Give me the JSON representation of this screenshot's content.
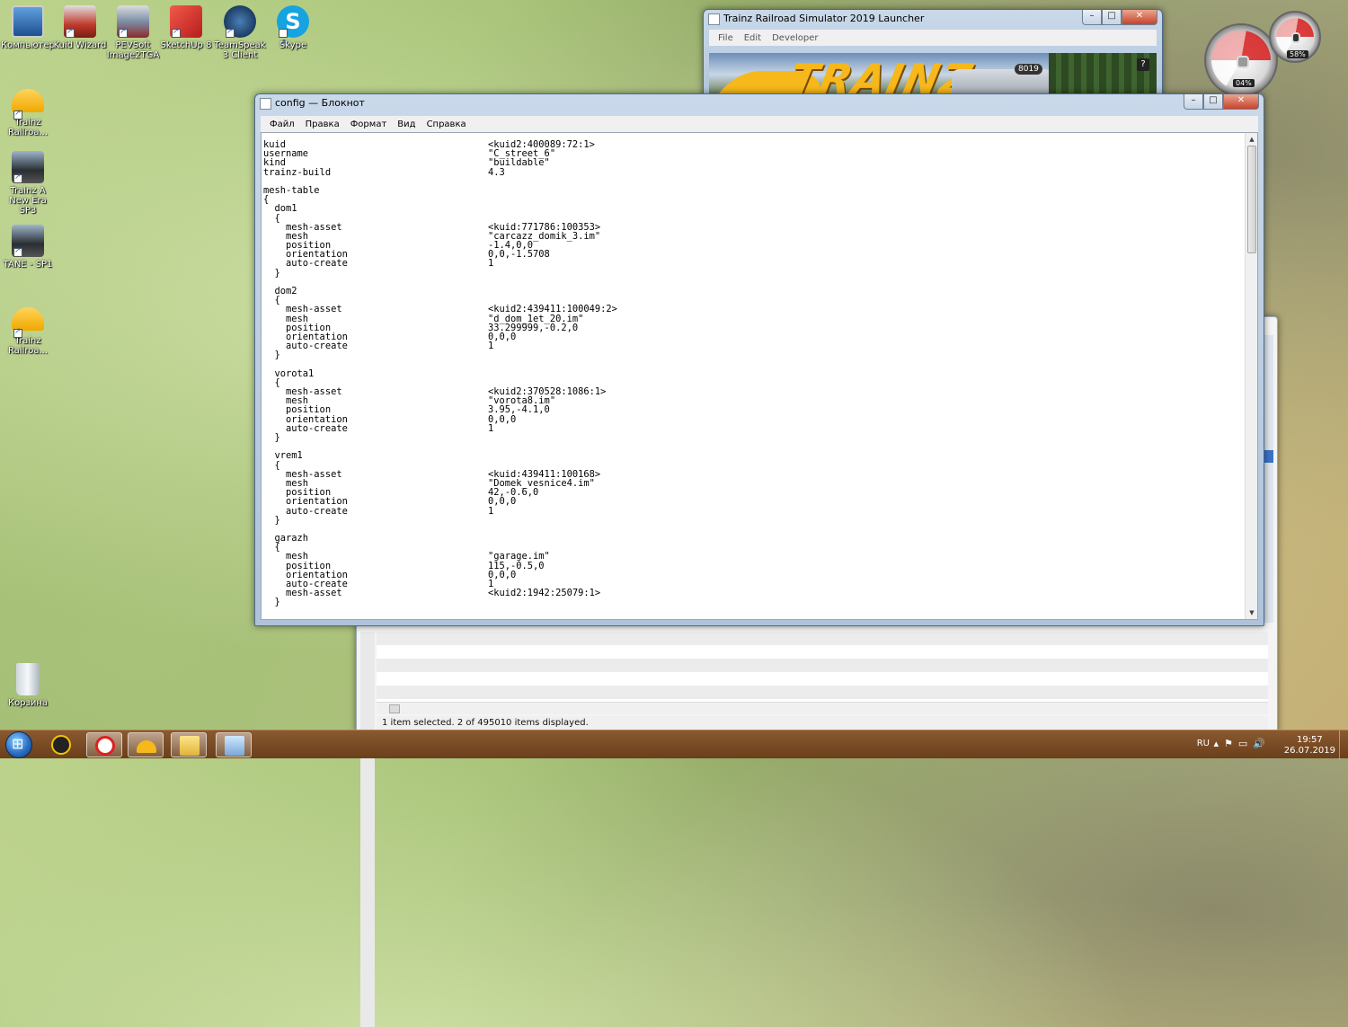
{
  "desktop": {
    "icons": [
      {
        "label": "Компьютер"
      },
      {
        "label": "Kuid Wizard"
      },
      {
        "label": "PEVSoft Image2TGA"
      },
      {
        "label": "SketchUp 8"
      },
      {
        "label": "TeamSpeak 3 Client"
      },
      {
        "label": "Skype"
      },
      {
        "label": "Trainz Railroa..."
      },
      {
        "label": "Trainz A New Era SP3"
      },
      {
        "label": "TANE - SP1"
      },
      {
        "label": "Trainz Railroa..."
      },
      {
        "label": "Корзина"
      }
    ]
  },
  "launcher": {
    "title": "Trainz Railroad Simulator 2019 Launcher",
    "menu": [
      "File",
      "Edit",
      "Developer"
    ],
    "logo_text": "TRAINZ",
    "loco_number": "8019",
    "help_label": "?"
  },
  "gadget": {
    "cpu_percent": "04%",
    "mem_percent": "58%"
  },
  "explorer": {
    "status_text": "1 item selected. 2 of 495010 items displayed."
  },
  "notepad": {
    "title": "config — Блокнот",
    "menu": [
      "Файл",
      "Правка",
      "Формат",
      "Вид",
      "Справка"
    ],
    "lines": [
      {
        "key": "kuid",
        "value": "<kuid2:400089:72:1>"
      },
      {
        "key": "username",
        "value": "\"C_street_6\""
      },
      {
        "key": "kind",
        "value": "\"buildable\""
      },
      {
        "key": "trainz-build",
        "value": "4.3"
      },
      {
        "key": "",
        "value": ""
      },
      {
        "key": "mesh-table",
        "value": ""
      },
      {
        "key": "{",
        "value": ""
      },
      {
        "key": "  dom1",
        "value": ""
      },
      {
        "key": "  {",
        "value": ""
      },
      {
        "key": "    mesh-asset",
        "value": "<kuid:771786:100353>"
      },
      {
        "key": "    mesh",
        "value": "\"carcazz_domik_3.im\""
      },
      {
        "key": "    position",
        "value": "-1.4,0,0"
      },
      {
        "key": "    orientation",
        "value": "0,0,-1.5708"
      },
      {
        "key": "    auto-create",
        "value": "1"
      },
      {
        "key": "  }",
        "value": ""
      },
      {
        "key": "",
        "value": ""
      },
      {
        "key": "  dom2",
        "value": ""
      },
      {
        "key": "  {",
        "value": ""
      },
      {
        "key": "    mesh-asset",
        "value": "<kuid2:439411:100049:2>"
      },
      {
        "key": "    mesh",
        "value": "\"d_dom_1et_20.im\""
      },
      {
        "key": "    position",
        "value": "33.299999,-0.2,0"
      },
      {
        "key": "    orientation",
        "value": "0,0,0"
      },
      {
        "key": "    auto-create",
        "value": "1"
      },
      {
        "key": "  }",
        "value": ""
      },
      {
        "key": "",
        "value": ""
      },
      {
        "key": "  vorota1",
        "value": ""
      },
      {
        "key": "  {",
        "value": ""
      },
      {
        "key": "    mesh-asset",
        "value": "<kuid2:370528:1086:1>"
      },
      {
        "key": "    mesh",
        "value": "\"vorota8.im\""
      },
      {
        "key": "    position",
        "value": "3.95,-4.1,0"
      },
      {
        "key": "    orientation",
        "value": "0,0,0"
      },
      {
        "key": "    auto-create",
        "value": "1"
      },
      {
        "key": "  }",
        "value": ""
      },
      {
        "key": "",
        "value": ""
      },
      {
        "key": "  vrem1",
        "value": ""
      },
      {
        "key": "  {",
        "value": ""
      },
      {
        "key": "    mesh-asset",
        "value": "<kuid:439411:100168>"
      },
      {
        "key": "    mesh",
        "value": "\"Domek_vesnice4.im\""
      },
      {
        "key": "    position",
        "value": "42,-0.6,0"
      },
      {
        "key": "    orientation",
        "value": "0,0,0"
      },
      {
        "key": "    auto-create",
        "value": "1"
      },
      {
        "key": "  }",
        "value": ""
      },
      {
        "key": "",
        "value": ""
      },
      {
        "key": "  garazh",
        "value": ""
      },
      {
        "key": "  {",
        "value": ""
      },
      {
        "key": "    mesh",
        "value": "\"garage.im\""
      },
      {
        "key": "    position",
        "value": "115,-0.5,0"
      },
      {
        "key": "    orientation",
        "value": "0,0,0"
      },
      {
        "key": "    auto-create",
        "value": "1"
      },
      {
        "key": "    mesh-asset",
        "value": "<kuid2:1942:25079:1>"
      },
      {
        "key": "  }",
        "value": ""
      }
    ]
  },
  "taskbar": {
    "language": "RU",
    "time": "19:57",
    "date": "26.07.2019"
  },
  "colors": {
    "taskbar": "#6b3f1b",
    "trainz_yellow": "#f6b81a",
    "selection_blue": "#3a74c8"
  }
}
